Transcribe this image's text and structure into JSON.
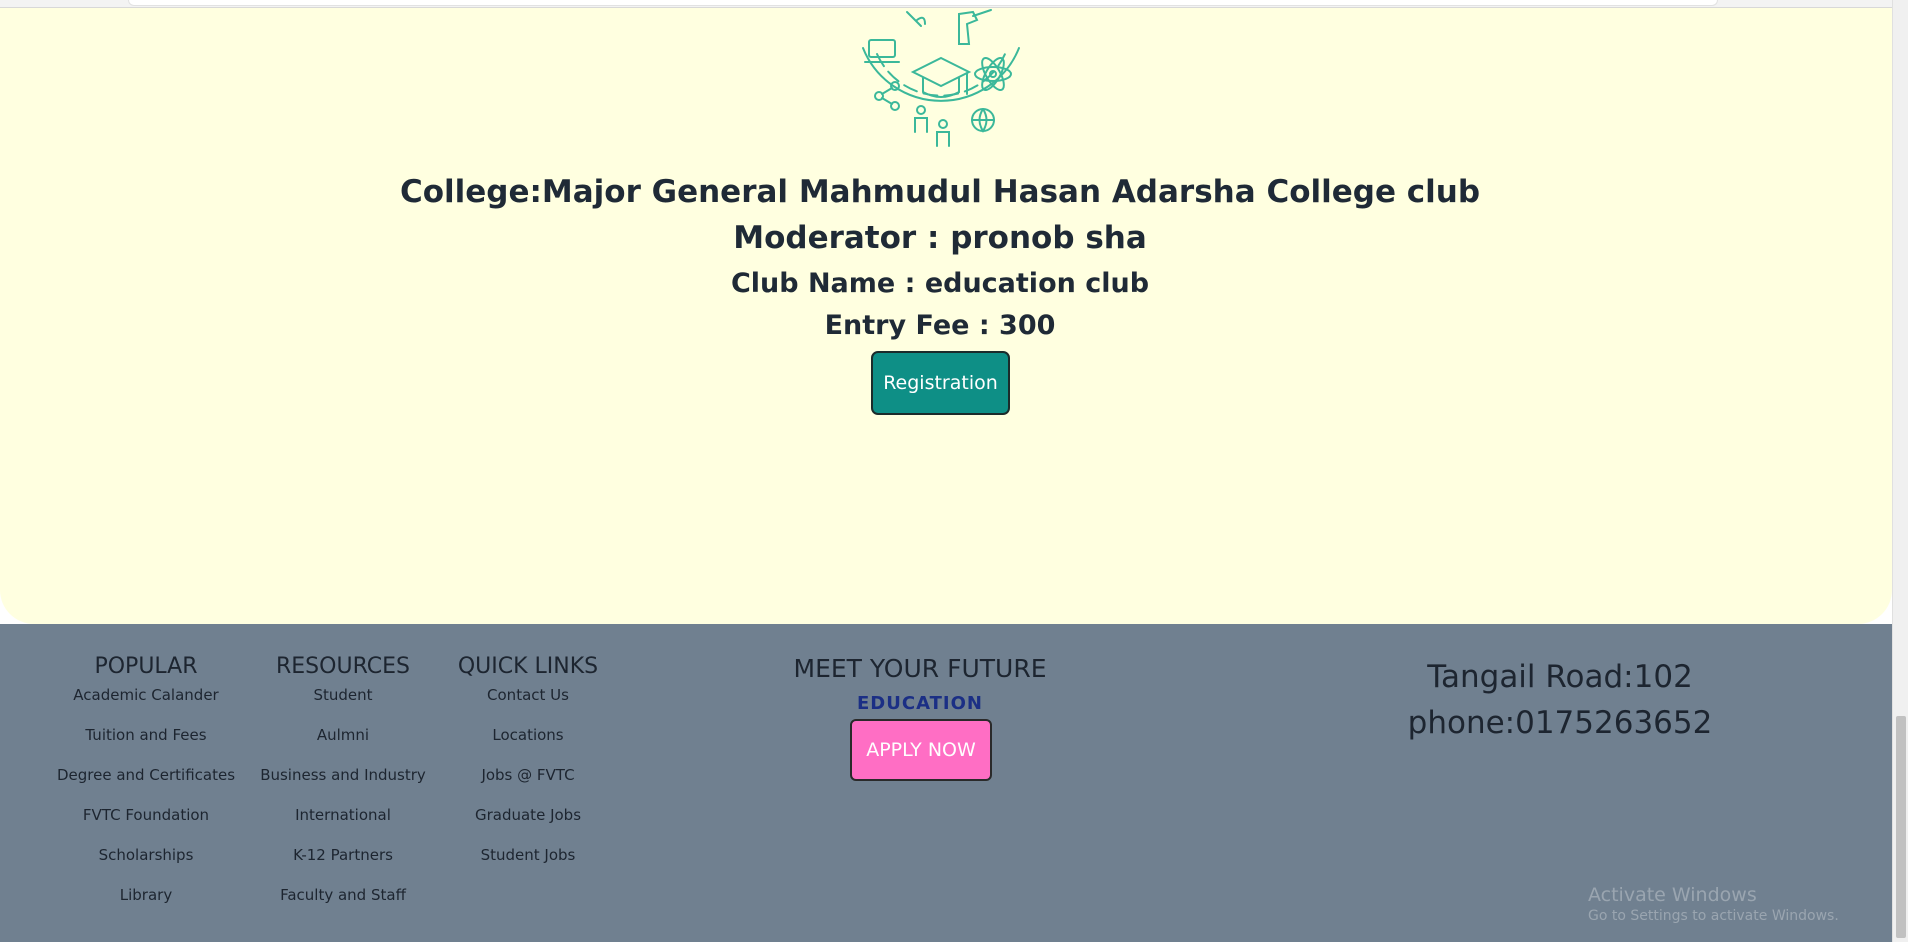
{
  "club": {
    "college": "College:Major General Mahmudul Hasan Adarsha College club",
    "moderator": "Moderator : pronob sha",
    "club_name": "Club Name : education club",
    "entry_fee": "Entry Fee : 300",
    "register_label": "Registration"
  },
  "footer": {
    "popular": {
      "title": "POPULAR",
      "links": [
        "Academic Calander",
        "Tuition and Fees",
        "Degree and Certificates",
        "FVTC Foundation",
        "Scholarships",
        "Library"
      ]
    },
    "resources": {
      "title": "RESOURCES",
      "links": [
        "Student",
        "Aulmni",
        "Business and Industry",
        "International",
        "K-12 Partners",
        "Faculty and Staff"
      ]
    },
    "quick_links": {
      "title": "QUICK LINKS",
      "links": [
        "Contact Us",
        "Locations",
        "Jobs @ FVTC",
        "Graduate Jobs",
        "Student Jobs"
      ]
    },
    "meet": {
      "title": "MEET YOUR FUTURE",
      "logo_text": "EDUCATION",
      "apply_label": "APPLY NOW"
    },
    "address": {
      "road": "Tangail Road:102",
      "phone": "phone:0175263652"
    }
  },
  "watermark": {
    "title": "Activate Windows",
    "subtitle": "Go to Settings to activate Windows."
  },
  "colors": {
    "content_bg": "#ffffe0",
    "footer_bg": "#708090",
    "register_button": "#0e8f86",
    "apply_button": "#ff6ec4",
    "logo_stroke": "#3bb89a"
  }
}
